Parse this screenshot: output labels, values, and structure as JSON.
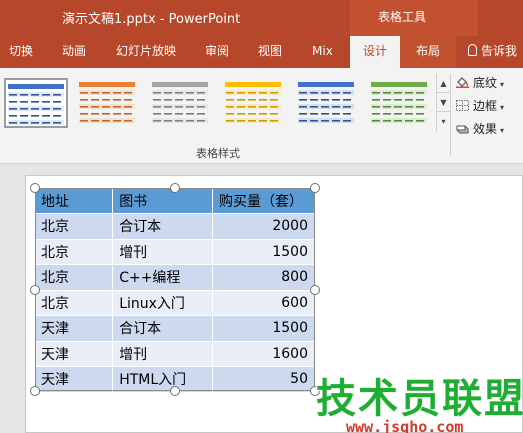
{
  "titlebar": {
    "doc_title": "演示文稿1.pptx - PowerPoint",
    "context_title": "表格工具"
  },
  "tabs": [
    {
      "label": "切换"
    },
    {
      "label": "动画"
    },
    {
      "label": "幻灯片放映"
    },
    {
      "label": "审阅"
    },
    {
      "label": "视图"
    },
    {
      "label": "Mix"
    },
    {
      "label": "设计",
      "active": true
    },
    {
      "label": "布局"
    }
  ],
  "tell_me": "告诉我",
  "ribbon": {
    "group_label": "表格样式",
    "table_styles": [
      {
        "header_color": "#4472c4",
        "line_color": "#2f4f8f",
        "selected": true
      },
      {
        "header_color": "#ed7d31",
        "line_color": "#c0612a"
      },
      {
        "header_color": "#a5a5a5",
        "line_color": "#7a7a7a"
      },
      {
        "header_color": "#ffc000",
        "line_color": "#c99700"
      },
      {
        "header_color": "#4472c4",
        "line_color": "#2f4f8f"
      },
      {
        "header_color": "#70ad47",
        "line_color": "#4f8a30"
      }
    ],
    "shading_label": "底纹",
    "borders_label": "边框",
    "effects_label": "效果"
  },
  "table": {
    "headers": [
      "地址",
      "图书",
      "购买量（套）"
    ],
    "rows": [
      [
        "北京",
        "合订本",
        "2000"
      ],
      [
        "北京",
        "增刊",
        "1500"
      ],
      [
        "北京",
        "C++编程",
        "800"
      ],
      [
        "北京",
        "Linux入门",
        "600"
      ],
      [
        "天津",
        "合订本",
        "1500"
      ],
      [
        "天津",
        "增刊",
        "1600"
      ],
      [
        "天津",
        "HTML入门",
        "50"
      ]
    ],
    "header_color": "#5b9bd5",
    "band_color_1": "#cdd9ee",
    "band_color_2": "#e8edf7"
  },
  "watermark": {
    "main": "技术员联盟",
    "url": "www.jsgho.com"
  }
}
